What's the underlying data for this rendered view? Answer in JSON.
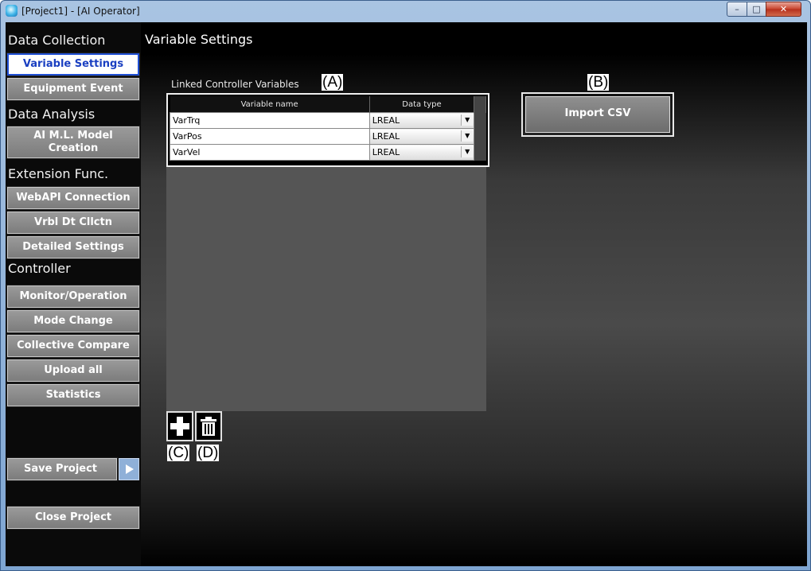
{
  "window": {
    "title": "[Project1] - [AI Operator]"
  },
  "sidebar": {
    "sections": [
      {
        "label": "Data Collection"
      },
      {
        "label": "Data Analysis"
      },
      {
        "label": "Extension Func."
      },
      {
        "label": "Controller"
      }
    ],
    "buttons": {
      "variable_settings": "Variable Settings",
      "equipment_event": "Equipment Event",
      "ai_model_line1": "AI M.L. Model",
      "ai_model_line2": "Creation",
      "webapi": "WebAPI Connection",
      "vrbl": "Vrbl Dt Cllctn",
      "detailed": "Detailed Settings",
      "monitor": "Monitor/Operation",
      "mode_change": "Mode Change",
      "collective_compare": "Collective Compare",
      "upload_all": "Upload all",
      "statistics": "Statistics",
      "save_project": "Save Project",
      "close_project": "Close Project"
    }
  },
  "main": {
    "title": "Variable Settings",
    "linked_label": "Linked Controller Variables",
    "import_csv": "Import CSV",
    "callouts": {
      "a": "(A)",
      "b": "(B)",
      "c": "(C)",
      "d": "(D)"
    },
    "table": {
      "headers": [
        "Variable name",
        "Data type"
      ],
      "rows": [
        {
          "name": "VarTrq",
          "type": "LREAL"
        },
        {
          "name": "VarPos",
          "type": "LREAL"
        },
        {
          "name": "VarVel",
          "type": "LREAL"
        }
      ]
    }
  }
}
